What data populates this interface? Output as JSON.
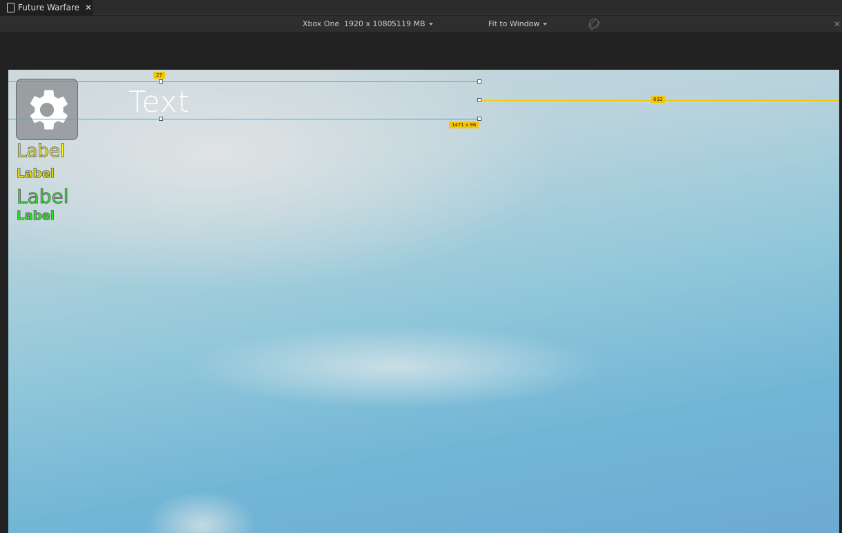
{
  "tab": {
    "title": "Future Warfare",
    "icon": "document-icon"
  },
  "toolbar": {
    "device": "Xbox One",
    "resolution": "1920 x 1080",
    "memory": "5119 MB",
    "fit": "Fit to Window"
  },
  "canvas": {
    "text_element": "Text",
    "labels": [
      "Label",
      "Label",
      "Label",
      "Label"
    ],
    "badges": {
      "top_offset": "27",
      "size": "1471 x 86",
      "right_offset": "832"
    }
  },
  "colors": {
    "guide": "#3aa8f0",
    "badge": "#f7c600",
    "yellow_label": "#ffff1a",
    "green_label": "#22ee22"
  }
}
